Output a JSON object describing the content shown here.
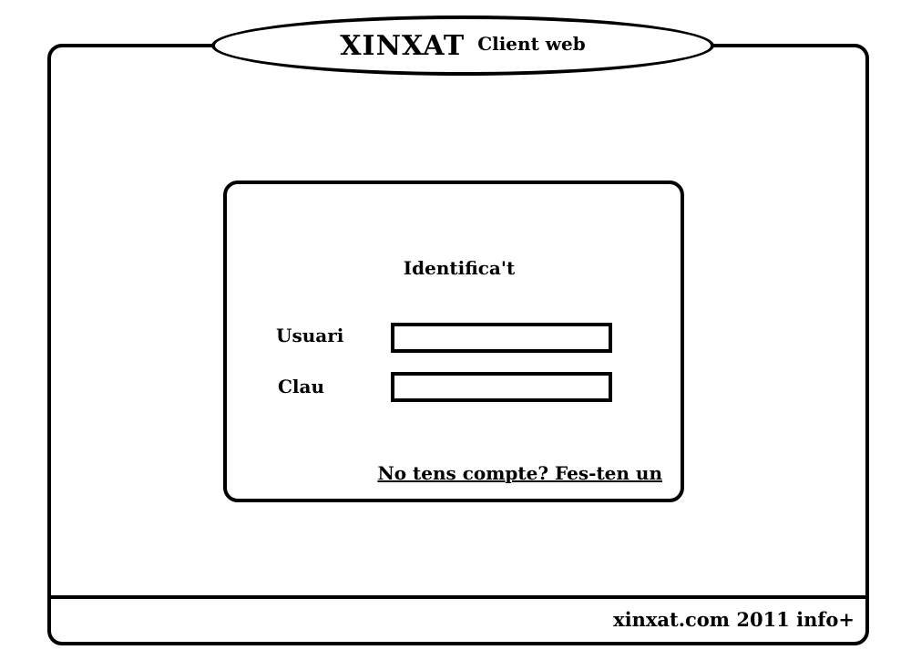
{
  "header": {
    "app_name": "XINXAT",
    "subtitle": "Client web"
  },
  "login": {
    "heading": "Identifica't",
    "user_label": "Usuari",
    "user_value": "",
    "password_label": "Clau",
    "password_value": "",
    "register_link": "No tens compte? Fes-ten un"
  },
  "footer": {
    "site": "xinxat.com",
    "year": "2011",
    "info_link": "info+"
  },
  "colors": {
    "stroke": "#000000",
    "background": "#ffffff"
  }
}
